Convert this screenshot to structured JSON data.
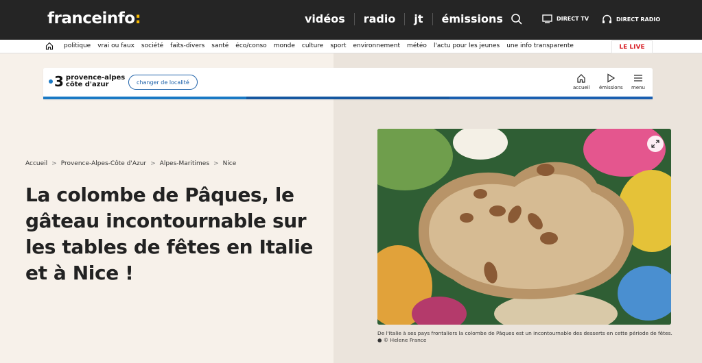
{
  "header": {
    "logo": "franceinfo",
    "logo_suffix": ":",
    "nav": [
      "vidéos",
      "radio",
      "jt",
      "émissions"
    ],
    "direct_tv": "DIRECT TV",
    "direct_radio": "DIRECT RADIO"
  },
  "categories": [
    "politique",
    "vrai ou faux",
    "société",
    "faits-divers",
    "santé",
    "éco/conso",
    "monde",
    "culture",
    "sport",
    "environnement",
    "météo",
    "l'actu pour les jeunes",
    "une info transparente"
  ],
  "live_label": "LE LIVE",
  "region": {
    "number": "3",
    "name_line1": "provence-alpes",
    "name_line2": "côte d'azur",
    "change_label": "changer de localité",
    "nav": [
      "accueil",
      "émissions",
      "menu"
    ]
  },
  "breadcrumb": [
    "Accueil",
    "Provence-Alpes-Côte d'Azur",
    "Alpes-Maritimes",
    "Nice"
  ],
  "headline": "La colombe de Pâques, le gâteau incontournable sur les tables de fêtes en Italie et à Nice !",
  "caption": "De l'Italie à ses pays frontaliers la colombe de Pâques est un incontournable des desserts en cette période de fêtes.",
  "credit": "● © Helene France",
  "colors": {
    "header_bg": "#252525",
    "accent": "#f4b800",
    "live_red": "#d8232a",
    "region_blue": "#1a79c4"
  }
}
